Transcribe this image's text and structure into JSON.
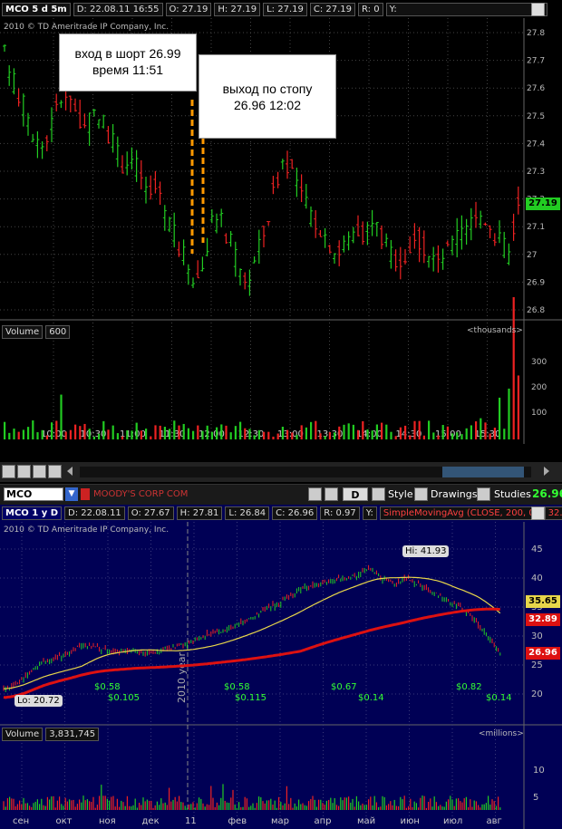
{
  "top": {
    "symbol": "MCO 5 d 5m",
    "fields": [
      "D: 22.08.11 16:55",
      "O: 27.19",
      "H: 27.19",
      "L: 27.19",
      "C: 27.19",
      "R: 0",
      "Y:"
    ],
    "company": "2010 © TD Ameritrade IP Company, Inc.",
    "price_tag": "27.19",
    "y_ticks": [
      "27.8",
      "27.7",
      "27.6",
      "27.5",
      "27.4",
      "27.3",
      "27.2",
      "27.1",
      "27",
      "26.9",
      "26.8"
    ],
    "note_entry": {
      "line1": "вход в шорт 26.99",
      "line2": "время 11:51"
    },
    "note_exit": {
      "line1": "выход по стопу",
      "line2": "26.96 12:02"
    },
    "volume_label": "Volume",
    "volume_value": "600",
    "volume_units": "<thousands>",
    "vol_ticks": [
      "300",
      "200",
      "100"
    ],
    "x_ticks": [
      "10:00",
      "10:30",
      "11:00",
      "11:30",
      "12:00",
      "12:30",
      "13:00",
      "13:30",
      "14:00",
      "14:30",
      "15:00",
      "15:30"
    ]
  },
  "symbar": {
    "symbol": "MCO",
    "company": "MOODY'S CORP COM",
    "period_button": "D",
    "style": "Style",
    "drawings": "Drawings",
    "studies": "Studies",
    "last": "26.96"
  },
  "bottom": {
    "symbol": "MCO 1 y D",
    "fields": [
      "D: 22.08.11",
      "O: 27.67",
      "H: 27.81",
      "L: 26.84",
      "C: 26.96",
      "R: 0.97",
      "Y:"
    ],
    "study": "SimpleMovingAvg (CLOSE, 200, 0)",
    "study_value": "32....",
    "company": "2010 © TD Ameritrade IP Company, Inc.",
    "hi": "Hi: 41.93",
    "lo": "Lo: 20.72",
    "year_label": "2010 year",
    "y_ticks": [
      "45",
      "40",
      "35",
      "30",
      "25",
      "20"
    ],
    "tags": {
      "sma50": "35.65",
      "sma200": "32.89",
      "last": "26.96"
    },
    "dividends": [
      "$0.58",
      "$0.105",
      "$0.58",
      "$0.115",
      "$0.67",
      "$0.14",
      "$0.82",
      "$0.14"
    ],
    "volume_label": "Volume",
    "volume_value": "3,831,745",
    "volume_units": "<millions>",
    "vol_ticks": [
      "10",
      "5"
    ],
    "x_ticks": [
      "сен",
      "окт",
      "ноя",
      "дек",
      "11",
      "фев",
      "мар",
      "апр",
      "май",
      "июн",
      "июл",
      "авг"
    ]
  },
  "colors": {
    "up": "#22cc22",
    "down": "#ee2222",
    "sma50": "#e8d64a",
    "sma200": "#dd1111",
    "navy": "#000055"
  }
}
